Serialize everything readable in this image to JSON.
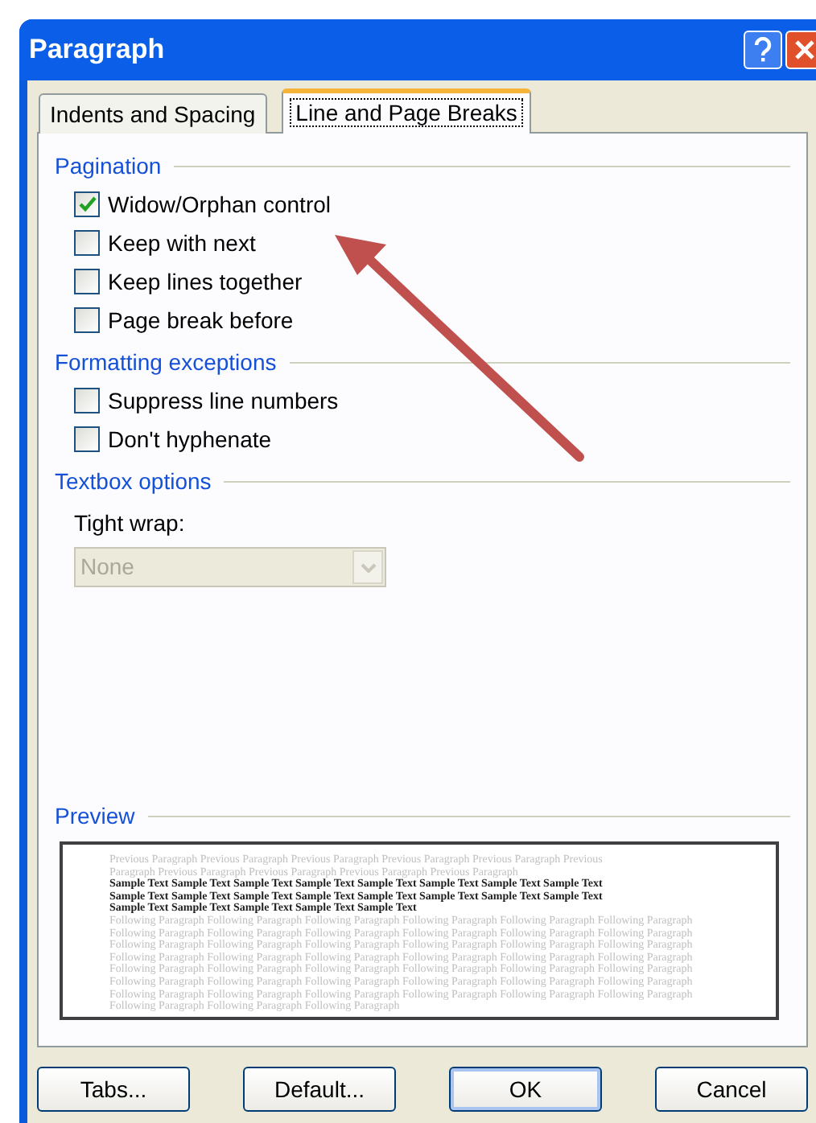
{
  "window": {
    "title": "Paragraph"
  },
  "tabs": [
    {
      "label": "Indents and Spacing",
      "selected": false
    },
    {
      "label": "Line and Page Breaks",
      "selected": true
    }
  ],
  "sections": [
    {
      "heading": "Pagination",
      "items": [
        {
          "kind": "checkbox",
          "label": "Widow/Orphan control",
          "checked": true
        },
        {
          "kind": "checkbox",
          "label": "Keep with next",
          "checked": false
        },
        {
          "kind": "checkbox",
          "label": "Keep lines together",
          "checked": false
        },
        {
          "kind": "checkbox",
          "label": "Page break before",
          "checked": false
        }
      ]
    },
    {
      "heading": "Formatting exceptions",
      "items": [
        {
          "kind": "checkbox",
          "label": "Suppress line numbers",
          "checked": false
        },
        {
          "kind": "checkbox",
          "label": "Don't hyphenate",
          "checked": false
        }
      ]
    },
    {
      "heading": "Textbox options",
      "items": [
        {
          "kind": "dropdown",
          "label": "Tight wrap:",
          "value": "None",
          "disabled": true
        }
      ]
    }
  ],
  "preview": {
    "heading": "Preview",
    "lines": [
      {
        "kind": "previous",
        "text": "Previous Paragraph Previous Paragraph Previous Paragraph Previous Paragraph Previous Paragraph Previous"
      },
      {
        "kind": "previous",
        "text": "Paragraph Previous Paragraph Previous Paragraph Previous Paragraph Previous Paragraph"
      },
      {
        "kind": "sample",
        "text": "Sample Text Sample Text Sample Text Sample Text Sample Text Sample Text Sample Text Sample Text"
      },
      {
        "kind": "sample",
        "text": "Sample Text Sample Text Sample Text Sample Text Sample Text Sample Text Sample Text Sample Text"
      },
      {
        "kind": "sample",
        "text": "Sample Text Sample Text Sample Text Sample Text Sample Text"
      },
      {
        "kind": "following",
        "text": "Following Paragraph Following Paragraph Following Paragraph Following Paragraph Following Paragraph Following Paragraph"
      },
      {
        "kind": "following",
        "text": "Following Paragraph Following Paragraph Following Paragraph Following Paragraph Following Paragraph Following Paragraph"
      },
      {
        "kind": "following",
        "text": "Following Paragraph Following Paragraph Following Paragraph Following Paragraph Following Paragraph Following Paragraph"
      },
      {
        "kind": "following",
        "text": "Following Paragraph Following Paragraph Following Paragraph Following Paragraph Following Paragraph Following Paragraph"
      },
      {
        "kind": "following",
        "text": "Following Paragraph Following Paragraph Following Paragraph Following Paragraph Following Paragraph Following Paragraph"
      },
      {
        "kind": "following",
        "text": "Following Paragraph Following Paragraph Following Paragraph Following Paragraph Following Paragraph Following Paragraph"
      },
      {
        "kind": "following",
        "text": "Following Paragraph Following Paragraph Following Paragraph Following Paragraph Following Paragraph Following Paragraph"
      },
      {
        "kind": "following",
        "text": "Following Paragraph Following Paragraph Following Paragraph"
      }
    ]
  },
  "buttons": [
    {
      "label": "Tabs...",
      "default": false
    },
    {
      "label": "Default...",
      "default": false
    },
    {
      "label": "OK",
      "default": true
    },
    {
      "label": "Cancel",
      "default": false
    }
  ]
}
